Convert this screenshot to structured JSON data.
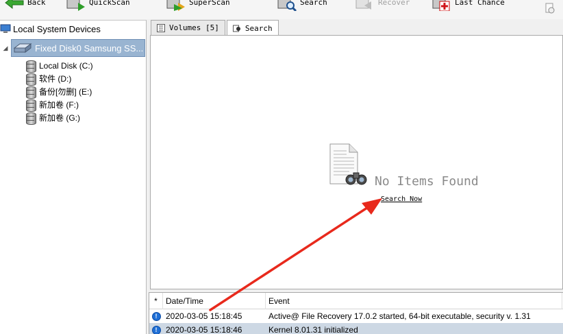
{
  "toolbar": {
    "back": "Back",
    "quickscan": "QuickScan",
    "superscan": "SuperScan",
    "search": "Search",
    "recover": "Recover",
    "last_chance": "Last Chance"
  },
  "tree": {
    "root_label": "Local System Devices",
    "disk_label": "Fixed Disk0 Samsung SS...",
    "volumes": [
      {
        "label": "Local Disk (C:)"
      },
      {
        "label": "软件 (D:)"
      },
      {
        "label": "备份[勿删] (E:)"
      },
      {
        "label": "新加卷 (F:)"
      },
      {
        "label": "新加卷 (G:)"
      }
    ]
  },
  "tabs": [
    {
      "label": "Volumes [5]"
    },
    {
      "label": "Search"
    }
  ],
  "content": {
    "empty_title": "No Items Found",
    "search_now": "Search Now"
  },
  "log": {
    "headers": {
      "star": "*",
      "date": "Date/Time",
      "event": "Event"
    },
    "rows": [
      {
        "date": "2020-03-05 15:18:45",
        "event": "Active@ File Recovery 17.0.2 started, 64-bit executable, security v. 1.31"
      },
      {
        "date": "2020-03-05 15:18:46",
        "event": "Kernel 8.01.31 initialized"
      }
    ]
  },
  "colors": {
    "selection": "#99b4d1",
    "annotation_arrow": "#e8291c",
    "info_icon": "#1f6fd6"
  }
}
